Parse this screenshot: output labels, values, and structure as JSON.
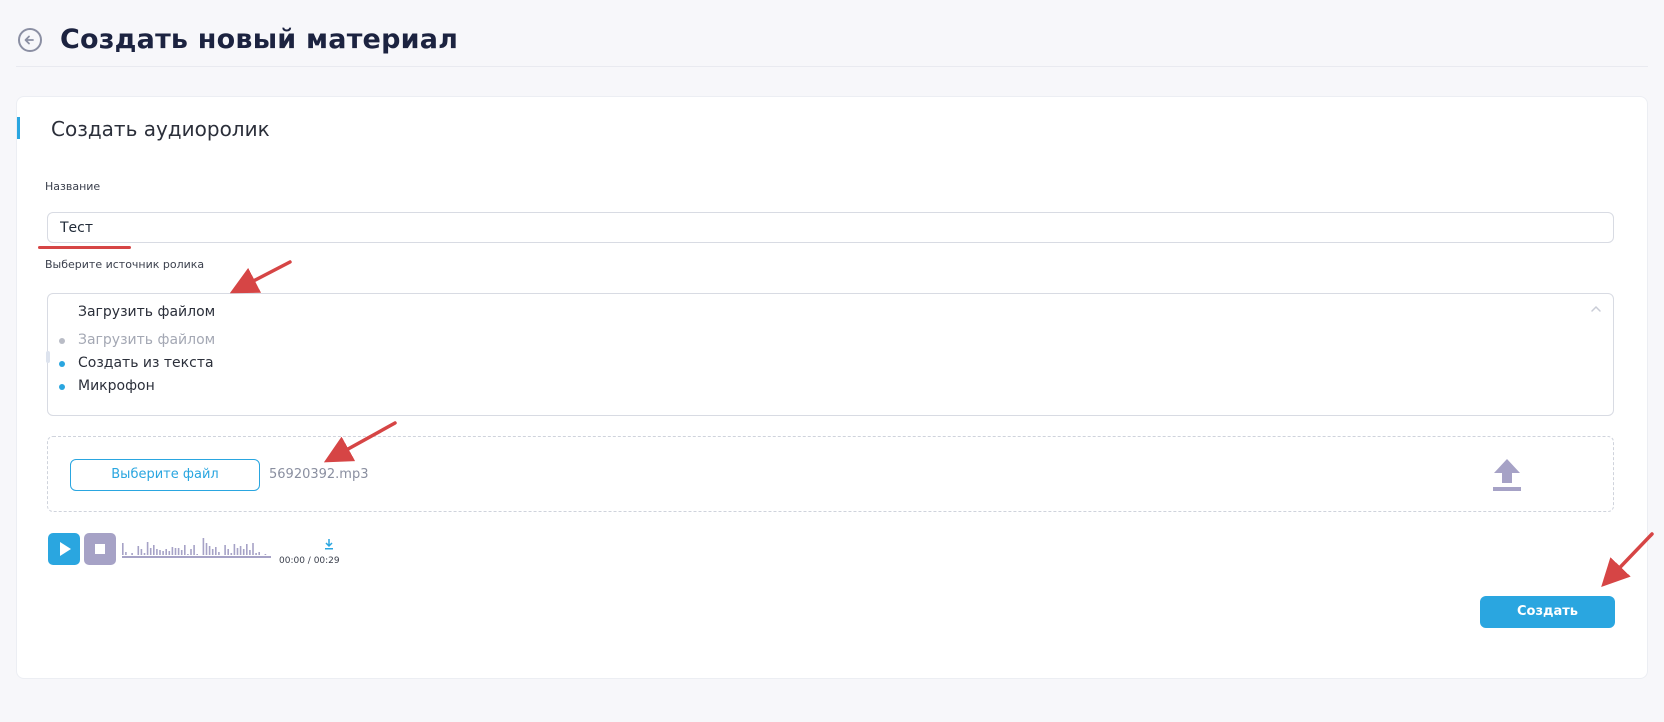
{
  "header": {
    "title": "Создать новый материал",
    "back_icon": "arrow-left-circle-icon"
  },
  "card": {
    "title": "Создать аудиоролик"
  },
  "name_field": {
    "label": "Название",
    "value": "Тест"
  },
  "source_select": {
    "label": "Выберите источник ролика",
    "selected": "Загрузить файлом",
    "options": [
      {
        "label": "Загрузить файлом",
        "state": "selected"
      },
      {
        "label": "Создать из текста",
        "state": "normal"
      },
      {
        "label": "Микрофон",
        "state": "normal"
      }
    ]
  },
  "upload": {
    "choose_button": "Выберите файл",
    "file_name": "56920392.mp3",
    "icon": "upload-arrow-icon"
  },
  "player": {
    "time": "00:00 / 00:29",
    "play_icon": "play-icon",
    "stop_icon": "stop-icon",
    "download_icon": "download-icon"
  },
  "actions": {
    "create_button": "Создать"
  },
  "colors": {
    "accent": "#2aa6e0",
    "muted_purple": "#a6a2c6",
    "annotation_red": "#d64545"
  }
}
